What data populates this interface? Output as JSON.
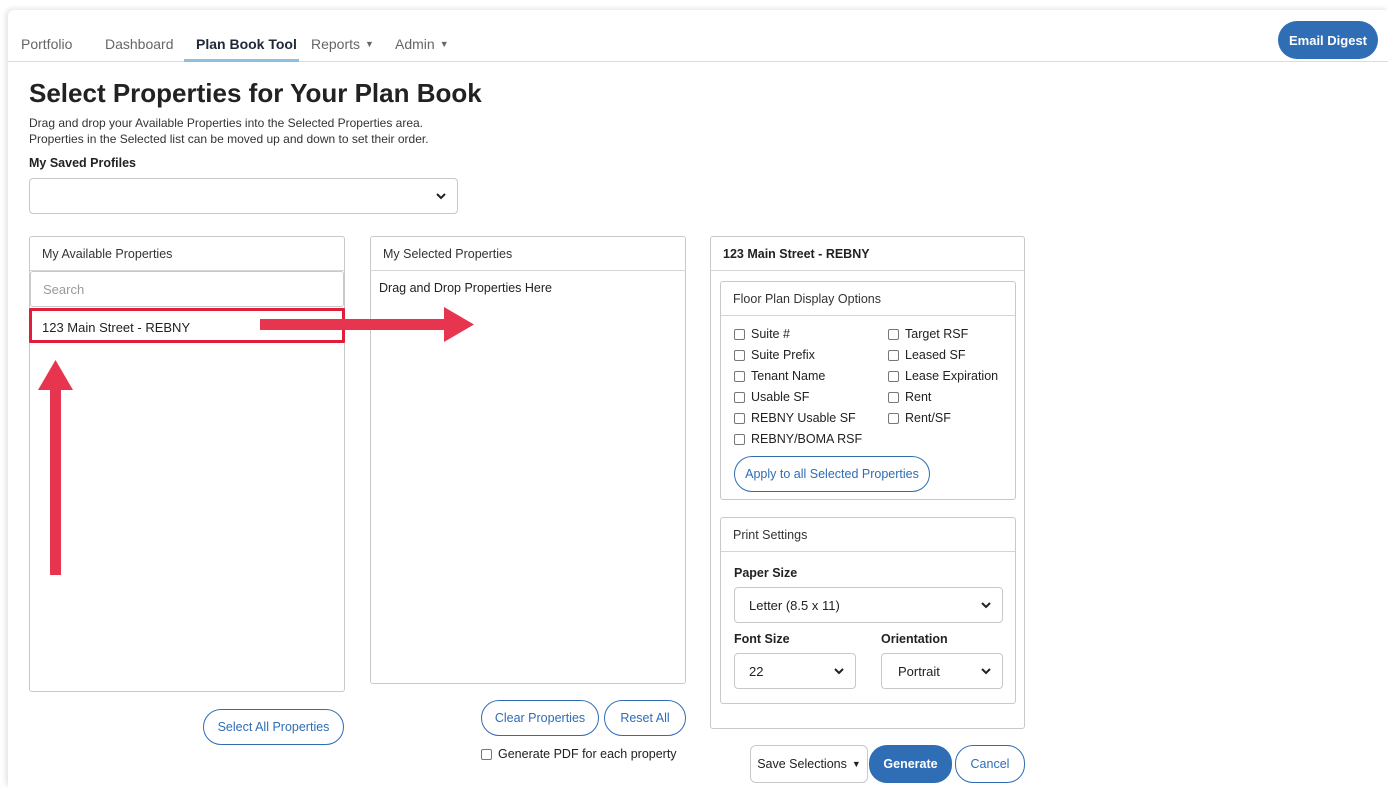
{
  "nav": {
    "tabs": [
      {
        "label": "Portfolio"
      },
      {
        "label": "Dashboard"
      },
      {
        "label": "Plan Book Tool"
      },
      {
        "label": "Reports"
      },
      {
        "label": "Admin"
      }
    ],
    "email_digest": "Email Digest"
  },
  "header": {
    "title": "Select Properties for Your Plan Book",
    "desc_line1": "Drag and drop your Available Properties into the Selected Properties area.",
    "desc_line2": "Properties in the Selected list can be moved up and down to set their order."
  },
  "profiles": {
    "label": "My Saved Profiles",
    "selected": ""
  },
  "available": {
    "title": "My Available Properties",
    "search_placeholder": "Search",
    "items": [
      "123 Main Street - REBNY"
    ],
    "select_all": "Select All Properties"
  },
  "selected": {
    "title": "My Selected Properties",
    "hint": "Drag and Drop Properties Here",
    "clear": "Clear Properties",
    "reset": "Reset All",
    "pdf_each": "Generate PDF for each property"
  },
  "details": {
    "title": "123 Main Street - REBNY",
    "floor_plan": {
      "title": "Floor Plan Display Options",
      "left": [
        "Suite #",
        "Suite Prefix",
        "Tenant Name",
        "Usable SF",
        "REBNY Usable SF",
        "REBNY/BOMA RSF"
      ],
      "right": [
        "Target RSF",
        "Leased SF",
        "Lease Expiration",
        "Rent",
        "Rent/SF"
      ],
      "apply": "Apply to all Selected Properties"
    },
    "print": {
      "title": "Print Settings",
      "paper_label": "Paper Size",
      "paper_value": "Letter (8.5 x 11)",
      "font_label": "Font Size",
      "font_value": "22",
      "orient_label": "Orientation",
      "orient_value": "Portrait"
    }
  },
  "actions": {
    "save": "Save Selections",
    "generate": "Generate",
    "cancel": "Cancel"
  },
  "colors": {
    "accent": "#2f6db5",
    "annotation": "#e11d3c"
  }
}
